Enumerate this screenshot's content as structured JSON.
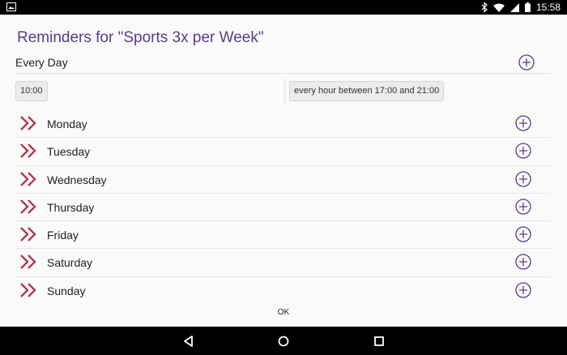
{
  "status_bar": {
    "time": "15:58",
    "icons": [
      "image-icon",
      "bluetooth-icon",
      "wifi-icon",
      "cellular-icon",
      "battery-icon"
    ]
  },
  "dialog": {
    "title": "Reminders for \"Sports 3x per Week\"",
    "every_day": {
      "label": "Every Day",
      "reminders": [
        {
          "text": "10:00"
        },
        {
          "text": "every hour between 17:00 and 21:00"
        }
      ]
    },
    "days": [
      {
        "label": "Monday"
      },
      {
        "label": "Tuesday"
      },
      {
        "label": "Wednesday"
      },
      {
        "label": "Thursday"
      },
      {
        "label": "Friday"
      },
      {
        "label": "Saturday"
      },
      {
        "label": "Sunday"
      }
    ],
    "ok_label": "OK"
  },
  "colors": {
    "title": "#5b3c86",
    "add_icon": "#5b3c86",
    "chevron": "#b3384f"
  },
  "nav_bar": {
    "icons": [
      "back-icon",
      "home-icon",
      "recents-icon"
    ]
  }
}
